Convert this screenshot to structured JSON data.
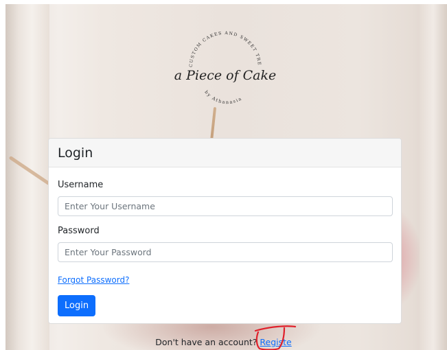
{
  "logo": {
    "arc_text": "CUSTOM CAKES AND SWEET TREATS",
    "name": "a Piece of Cake",
    "byline": "by Athanasia"
  },
  "login_card": {
    "title": "Login",
    "username_label": "Username",
    "username_placeholder": "Enter Your Username",
    "password_label": "Password",
    "password_placeholder": "Enter Your Password",
    "forgot_link": "Forgot Password?",
    "login_button": "Login"
  },
  "footer": {
    "prompt": "Don't have an account?",
    "register_link": "Registe"
  },
  "colors": {
    "primary": "#0d6efd",
    "annotation": "#e0202a"
  }
}
